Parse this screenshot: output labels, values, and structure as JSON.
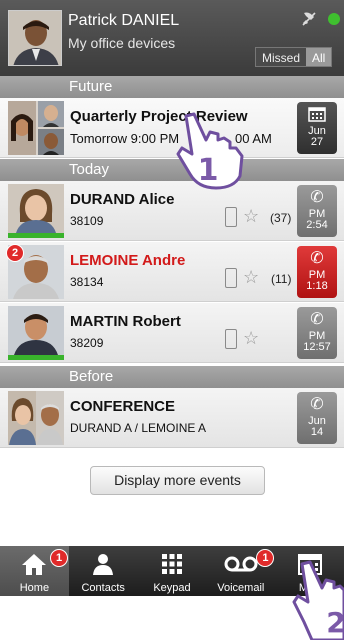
{
  "header": {
    "name": "Patrick DANIEL",
    "subtitle": "My office devices",
    "filter_missed": "Missed",
    "filter_all": "All"
  },
  "sections": {
    "future": "Future",
    "today": "Today",
    "before": "Before"
  },
  "events": [
    {
      "title": "Quarterly Project Review",
      "subtitle": "Tomorrow 9:00 PM",
      "subtitle_tail": "00 AM",
      "side_l1": "Jun",
      "side_l2": "27"
    },
    {
      "title": "DURAND Alice",
      "subtitle": "38109",
      "count": "(37)",
      "side_l1": "PM",
      "side_l2": "2:54"
    },
    {
      "title": "LEMOINE Andre",
      "subtitle": "38134",
      "count": "(11)",
      "badge": "2",
      "side_l1": "PM",
      "side_l2": "1:18"
    },
    {
      "title": "MARTIN Robert",
      "subtitle": "38209",
      "side_l1": "PM",
      "side_l2": "12:57"
    },
    {
      "title": "CONFERENCE",
      "subtitle": "DURAND A / LEMOINE A",
      "side_l1": "Jun",
      "side_l2": "14"
    }
  ],
  "more_button": "Display more events",
  "tabs": [
    {
      "label": "Home",
      "badge": "1"
    },
    {
      "label": "Contacts"
    },
    {
      "label": "Keypad"
    },
    {
      "label": "Voicemail",
      "badge": "1"
    },
    {
      "label": "Mee"
    }
  ],
  "annotations": {
    "step1": "1",
    "step2": "2"
  },
  "colors": {
    "presence": "#3fbf2f",
    "missed_red": "#d21a1a",
    "badge_red": "#e02a2a",
    "pointer_purple": "#7b5aa8"
  }
}
